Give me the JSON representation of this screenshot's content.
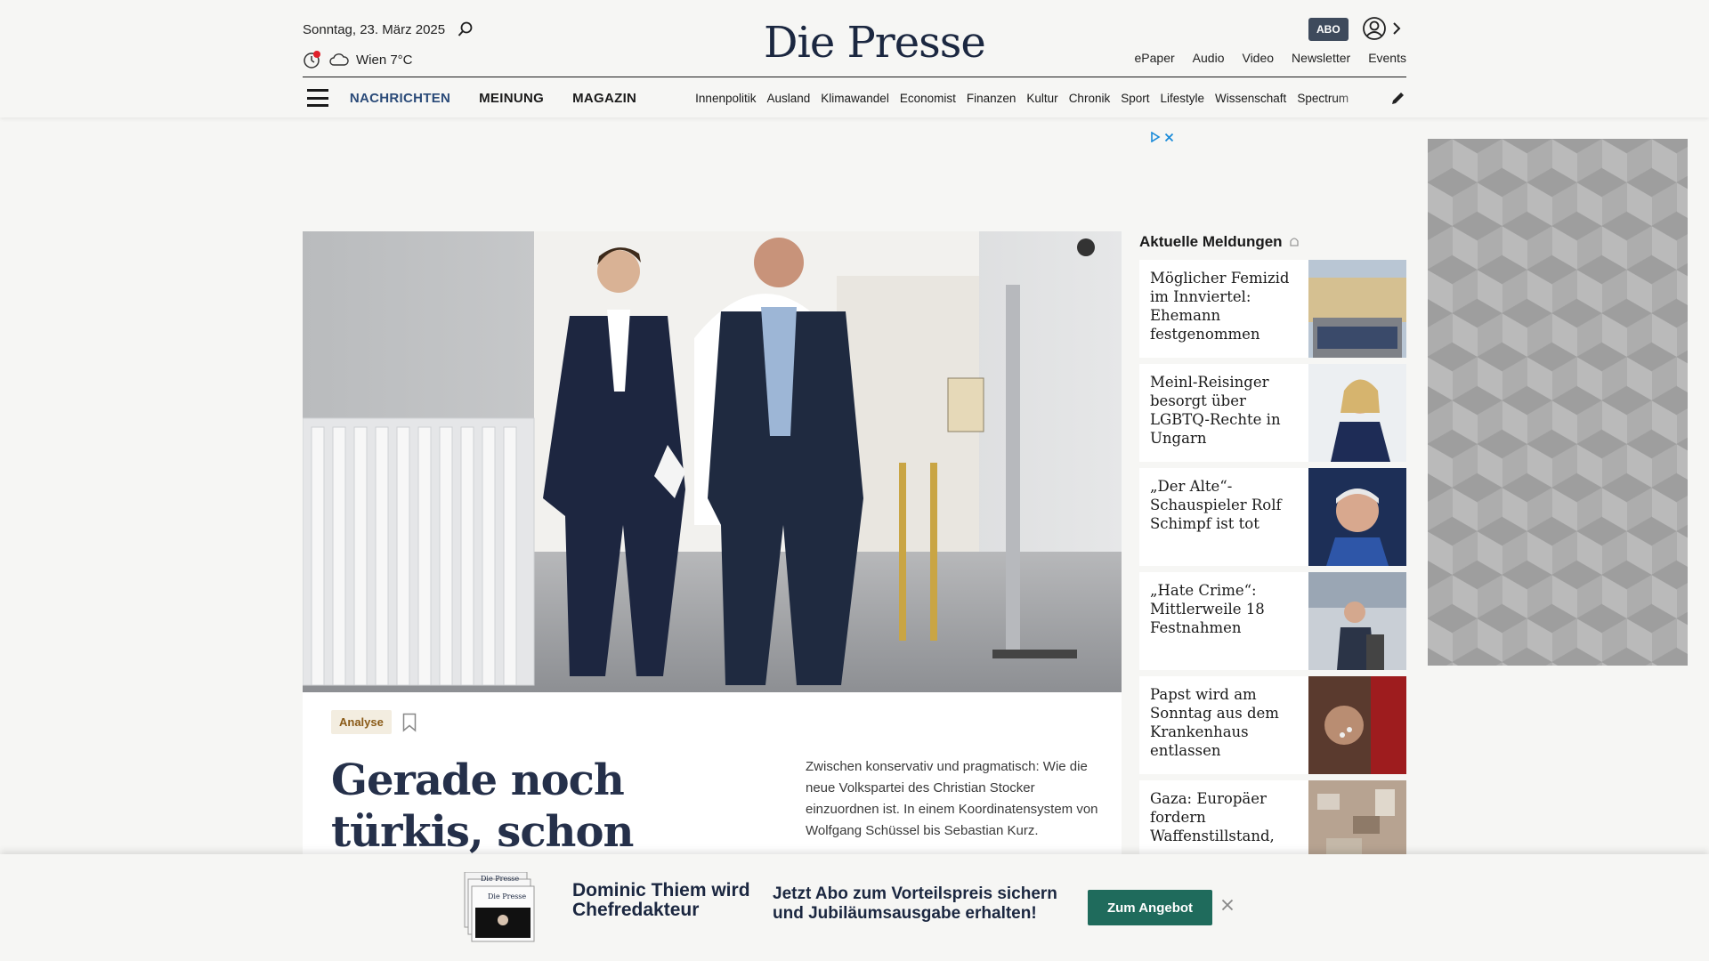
{
  "header": {
    "date": "Sonntag, 23. März 2025",
    "weather": "Wien 7°C",
    "logo": "Die Presse",
    "abo_label": "ABO",
    "top_links": [
      "ePaper",
      "Audio",
      "Video",
      "Newsletter",
      "Events"
    ]
  },
  "nav": {
    "main": [
      {
        "label": "NACHRICHTEN",
        "active": true
      },
      {
        "label": "MEINUNG",
        "active": false
      },
      {
        "label": "MAGAZIN",
        "active": false
      }
    ],
    "sections": [
      "Innenpolitik",
      "Ausland",
      "Klimawandel",
      "Economist",
      "Finanzen",
      "Kultur",
      "Chronik",
      "Sport",
      "Lifestyle",
      "Wissenschaft",
      "Spectrum"
    ]
  },
  "lead": {
    "tag": "Analyse",
    "headline": "Gerade noch türkis, schon wieder",
    "teaser": "Zwischen konservativ und pragmatisch: Wie die neue Volkspartei des Christian Stocker einzuordnen ist. In einem Koordinatensystem von Wolfgang Schüssel bis Sebastian Kurz."
  },
  "news": {
    "title": "Aktuelle Meldungen",
    "items": [
      {
        "text": "Möglicher Femizid im Innviertel: Ehemann festgenommen"
      },
      {
        "text": "Meinl-Reisinger besorgt über LGBTQ-Rechte in Ungarn"
      },
      {
        "text": "„Der Alte“-Schauspieler Rolf Schimpf ist tot"
      },
      {
        "text": "„Hate Crime“: Mittlerweile 18 Festnahmen"
      },
      {
        "text": "Papst wird am Sonntag aus dem Krankenhaus entlassen"
      },
      {
        "text": "Gaza: Europäer fordern Waffenstillstand,"
      }
    ]
  },
  "promo": {
    "name": "Dominic Thiem wird Chefredakteur",
    "offer": "Jetzt Abo zum Vorteilspreis sichern und Jubiläumsausgabe erhalten!",
    "button": "Zum Angebot",
    "paper_logo": "Die Presse"
  },
  "colors": {
    "brand_navy": "#1b2740",
    "nav_active": "#2a4a78",
    "tag_bg": "#f3ede0",
    "tag_text": "#8a5a17",
    "cta_green": "#1f6b5c",
    "background": "#f6f6f4"
  },
  "icons": [
    "search-icon",
    "clock-icon",
    "cloud-icon",
    "user-icon",
    "chevron-right-icon",
    "hamburger-icon",
    "pencil-icon",
    "adchoices-icon",
    "close-icon",
    "bookmark-icon",
    "camera-icon",
    "bell-icon"
  ]
}
